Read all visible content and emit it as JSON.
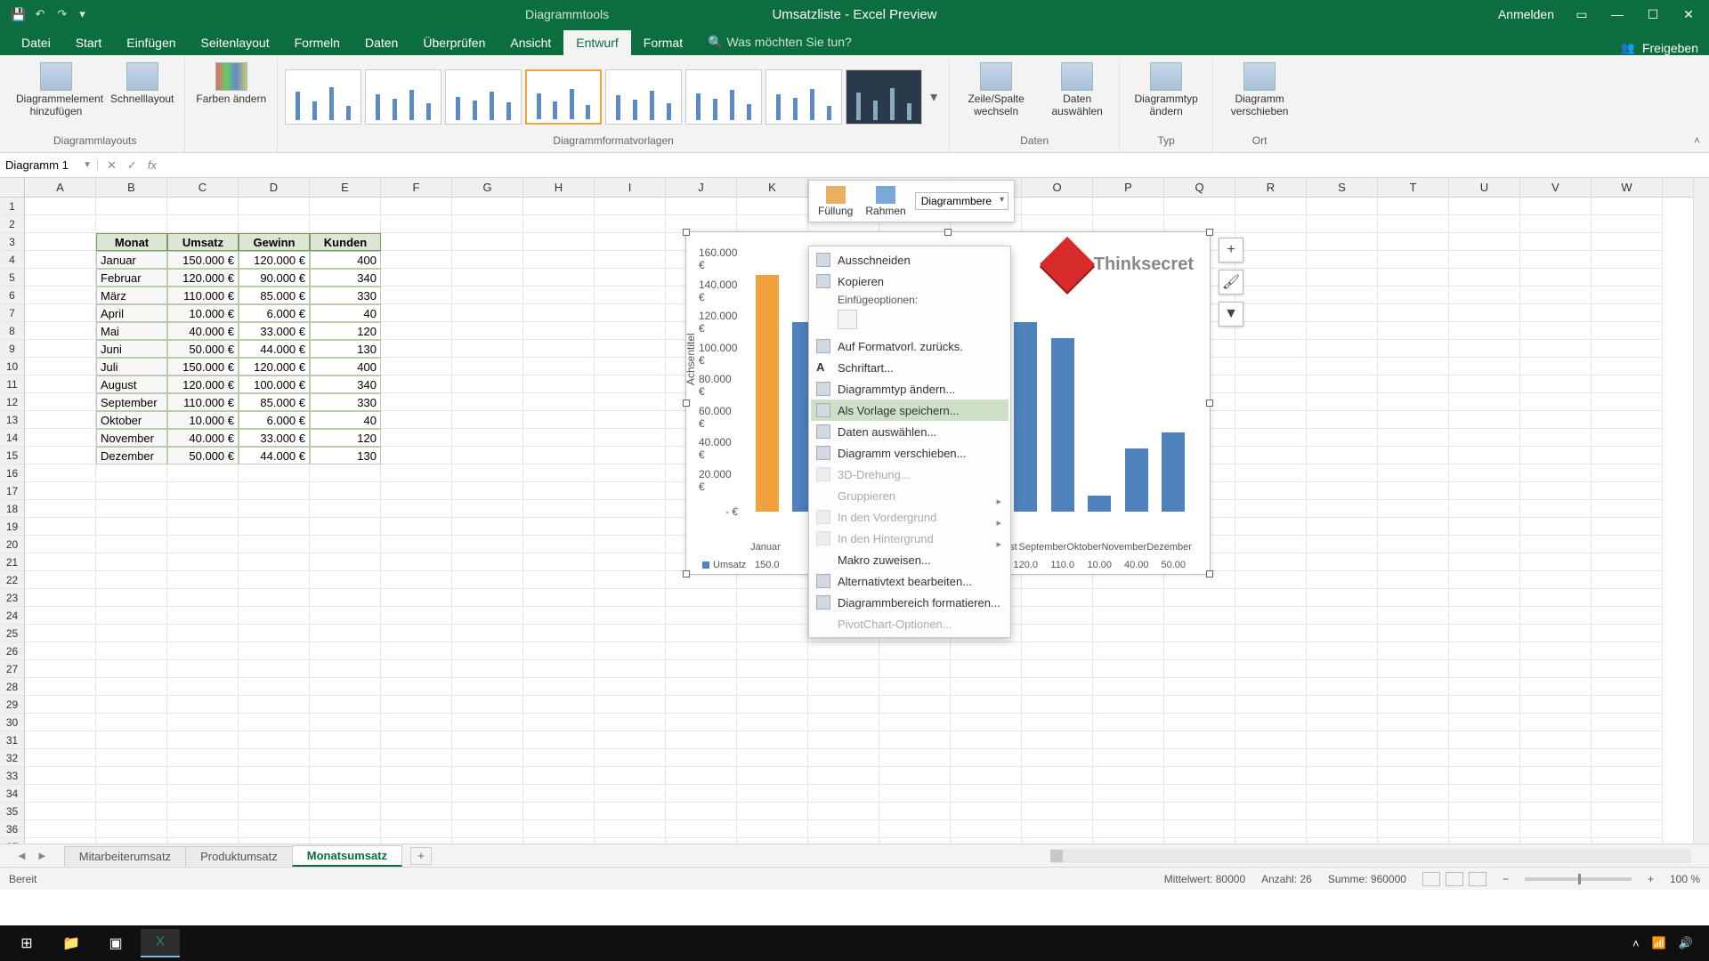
{
  "title": "Umsatzliste  -  Excel Preview",
  "contextual_tab": "Diagrammtools",
  "signin": "Anmelden",
  "tabs": [
    "Datei",
    "Start",
    "Einfügen",
    "Seitenlayout",
    "Formeln",
    "Daten",
    "Überprüfen",
    "Ansicht",
    "Entwurf",
    "Format"
  ],
  "active_tab": "Entwurf",
  "tellme": "Was möchten Sie tun?",
  "share": "Freigeben",
  "ribbon": {
    "g1": {
      "label": "Diagrammlayouts",
      "b1": "Diagrammelement hinzufügen",
      "b2": "Schnelllayout"
    },
    "g2": {
      "label": "",
      "b1": "Farben ändern"
    },
    "g3": {
      "label": "Diagrammformatvorlagen"
    },
    "g4": {
      "label": "Daten",
      "b1": "Zeile/Spalte wechseln",
      "b2": "Daten auswählen"
    },
    "g5": {
      "label": "Typ",
      "b1": "Diagrammtyp ändern"
    },
    "g6": {
      "label": "Ort",
      "b1": "Diagramm verschieben"
    }
  },
  "namebox": "Diagramm 1",
  "columns": [
    "A",
    "B",
    "C",
    "D",
    "E",
    "F",
    "G",
    "H",
    "I",
    "J",
    "K",
    "L",
    "M",
    "N",
    "O",
    "P",
    "Q",
    "R",
    "S",
    "T",
    "U",
    "V",
    "W"
  ],
  "table": {
    "headers": [
      "Monat",
      "Umsatz",
      "Gewinn",
      "Kunden"
    ],
    "rows": [
      [
        "Januar",
        "150.000 €",
        "120.000 €",
        "400"
      ],
      [
        "Februar",
        "120.000 €",
        "90.000 €",
        "340"
      ],
      [
        "März",
        "110.000 €",
        "85.000 €",
        "330"
      ],
      [
        "April",
        "10.000 €",
        "6.000 €",
        "40"
      ],
      [
        "Mai",
        "40.000 €",
        "33.000 €",
        "120"
      ],
      [
        "Juni",
        "50.000 €",
        "44.000 €",
        "130"
      ],
      [
        "Juli",
        "150.000 €",
        "120.000 €",
        "400"
      ],
      [
        "August",
        "120.000 €",
        "100.000 €",
        "340"
      ],
      [
        "September",
        "110.000 €",
        "85.000 €",
        "330"
      ],
      [
        "Oktober",
        "10.000 €",
        "6.000 €",
        "40"
      ],
      [
        "November",
        "40.000 €",
        "33.000 €",
        "120"
      ],
      [
        "Dezember",
        "50.000 €",
        "44.000 €",
        "130"
      ]
    ]
  },
  "mini_toolbar": {
    "fill": "Füllung",
    "outline": "Rahmen",
    "area": "Diagrammbere"
  },
  "context_menu": {
    "cut": "Ausschneiden",
    "copy": "Kopieren",
    "paste_opts": "Einfügeoptionen:",
    "reset": "Auf Formatvorl. zurücks.",
    "font": "Schriftart...",
    "change_type": "Diagrammtyp ändern...",
    "save_template": "Als Vorlage speichern...",
    "select_data": "Daten auswählen...",
    "move_chart": "Diagramm verschieben...",
    "rot3d": "3D-Drehung...",
    "group": "Gruppieren",
    "bring_front": "In den Vordergrund",
    "send_back": "In den Hintergrund",
    "assign_macro": "Makro zuweisen...",
    "alt_text": "Alternativtext bearbeiten...",
    "format_area": "Diagrammbereich formatieren...",
    "pivot_opts": "PivotChart-Optionen..."
  },
  "chart_data": {
    "type": "bar",
    "title": "",
    "y_title": "Achsentitel",
    "ylim": [
      0,
      160000
    ],
    "y_ticks": [
      "- €",
      "20.000 €",
      "40.000 €",
      "60.000 €",
      "80.000 €",
      "100.000 €",
      "120.000 €",
      "140.000 €",
      "160.000 €"
    ],
    "categories": [
      "Januar",
      "Februar",
      "März",
      "April",
      "Mai",
      "Juni",
      "Juli",
      "August",
      "September",
      "Oktober",
      "November",
      "Dezember"
    ],
    "x_labels_short": [
      "Januar",
      "",
      "",
      "",
      "",
      "",
      "",
      "August",
      "September",
      "Oktober",
      "November",
      "Dezember"
    ],
    "series": [
      {
        "name": "Umsatz",
        "values": [
          150000,
          120000,
          110000,
          10000,
          40000,
          50000,
          150000,
          120000,
          110000,
          10000,
          40000,
          50000
        ]
      }
    ],
    "data_table_row": [
      "150.0",
      "",
      "",
      "",
      "",
      "",
      "",
      "120.0",
      "110.0",
      "10.00",
      "40.00",
      "50.00"
    ],
    "logo_text": "Thinksecret"
  },
  "sheets": [
    "Mitarbeiterumsatz",
    "Produktumsatz",
    "Monatsumsatz"
  ],
  "active_sheet": "Monatsumsatz",
  "status": {
    "ready": "Bereit",
    "avg_label": "Mittelwert:",
    "avg": "80000",
    "count_label": "Anzahl:",
    "count": "26",
    "sum_label": "Summe:",
    "sum": "960000",
    "zoom": "100 %"
  }
}
